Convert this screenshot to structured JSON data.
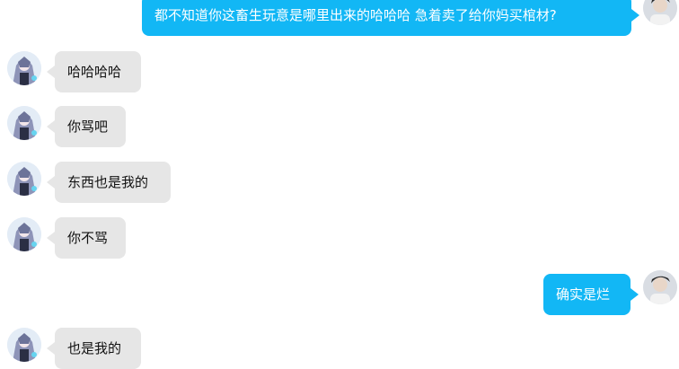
{
  "conversation": {
    "messages": [
      {
        "side": "right",
        "text": "都不知道你这畜生玩意是哪里出来的哈哈哈 急着卖了给你妈买棺材?"
      },
      {
        "side": "left",
        "text": "哈哈哈哈"
      },
      {
        "side": "left",
        "text": "你骂吧"
      },
      {
        "side": "left",
        "text": "东西也是我的"
      },
      {
        "side": "left",
        "text": "你不骂"
      },
      {
        "side": "right",
        "text": "确实是烂"
      },
      {
        "side": "left",
        "text": "也是我的"
      }
    ]
  },
  "colors": {
    "outgoing_bubble": "#12b7f5",
    "incoming_bubble": "#e6e6e6",
    "background": "#ffffff"
  },
  "icons": {
    "incoming_avatar": "anime-character-avatar",
    "outgoing_avatar": "person-photo-avatar"
  }
}
